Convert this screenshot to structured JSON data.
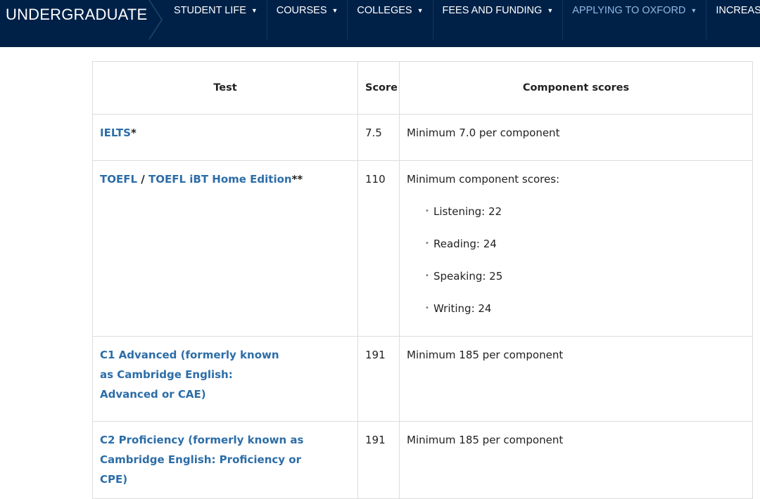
{
  "header": {
    "brand": "UNDERGRADUATE",
    "nav": [
      {
        "label": "STUDENT LIFE",
        "active": false
      },
      {
        "label": "COURSES",
        "active": false
      },
      {
        "label": "COLLEGES",
        "active": false
      },
      {
        "label": "FEES AND FUNDING",
        "active": false
      },
      {
        "label": "APPLYING TO OXFORD",
        "active": true
      },
      {
        "label": "INCREASING",
        "active": false
      }
    ]
  },
  "table": {
    "headers": {
      "test": "Test",
      "score": "Score",
      "components": "Component scores"
    },
    "rows": [
      {
        "test": "IELTS",
        "test_mark": "*",
        "score": "7.5",
        "components": "Minimum 7.0 per component"
      },
      {
        "test_a": "TOEFL",
        "sep": " / ",
        "test_b": "TOEFL iBT Home Edition",
        "test_mark": "**",
        "score": "110",
        "components": "Minimum component scores:",
        "items": [
          "Listening: 22",
          "Reading: 24",
          "Speaking: 25",
          "Writing: 24"
        ]
      },
      {
        "test": "C1 Advanced (formerly known as Cambridge English: Advanced or CAE)",
        "score": "191",
        "components": "Minimum 185 per component"
      },
      {
        "test": "C2 Proficiency (formerly known as Cambridge English: Proficiency or CPE)",
        "score": "191",
        "components": "Minimum 185 per component"
      }
    ]
  }
}
